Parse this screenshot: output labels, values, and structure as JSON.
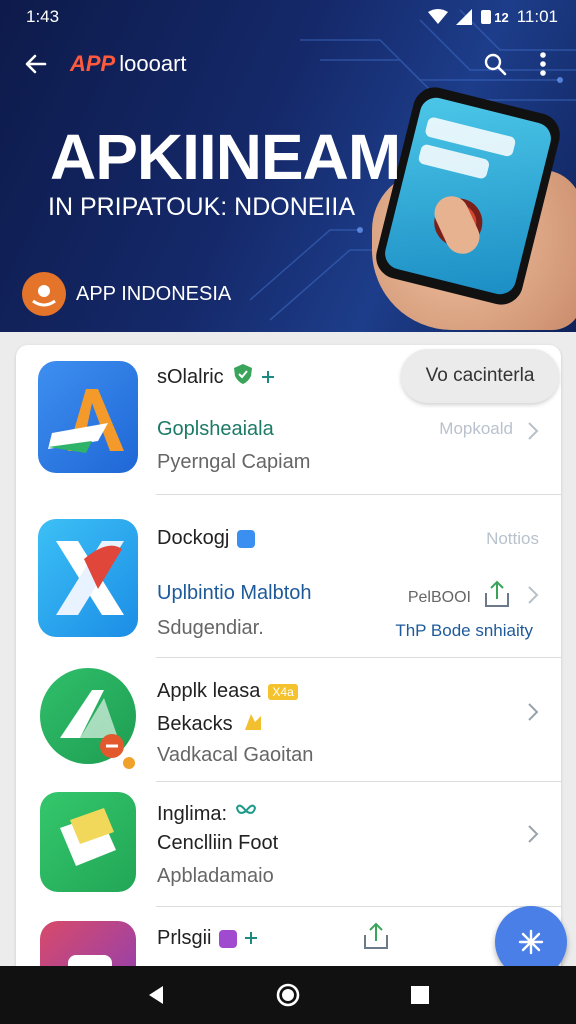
{
  "status_bar": {
    "left_time": "1:43",
    "right_time": "11:01",
    "sim_label": "12"
  },
  "header": {
    "brand_mark": "APP",
    "brand_name": "loooart",
    "hero_title": "APKIINEAM",
    "hero_subtitle": "IN PRIPATOUK: NDONEIIA",
    "badge_text": "APP INDONESIA"
  },
  "pill_button_label": "Vo cacinterla",
  "apps": [
    {
      "title": "sOlalric",
      "line2": "Goplsheaiala",
      "line3": "Pyerngal  Capiam",
      "right_label": "Mopkoald",
      "colors": {
        "bg1": "#3e8ff0",
        "bg2": "#1f67d6",
        "mark": "#f39a2b"
      }
    },
    {
      "title": "Dockogj",
      "line2": "Uplbintio Malbtoh",
      "line3": "Sdugendiar.",
      "right_label": "Nottios",
      "right_meta": "PelBOOI",
      "right_link": "ThP Bode snhiaity",
      "colors": {
        "bg1": "#3cc0f5",
        "bg2": "#1c8de6",
        "mark": "#e0463a"
      }
    },
    {
      "title": "Applk leasa",
      "title_badge": "X4a",
      "line2": "Bekacks",
      "line3": "Vadkacal Gaoitan",
      "colors": {
        "bg1": "#2fbf6a",
        "bg2": "#1f9d52",
        "mark": "#ffffff"
      }
    },
    {
      "title": "Inglima:",
      "line2": "Cenclliin Foot",
      "line3": "Apbladamaio",
      "colors": {
        "bg1": "#34c76c",
        "bg2": "#22a656",
        "mark": "#f2d85a"
      }
    },
    {
      "title": "Prlsgii",
      "colors": {
        "bg1": "#d84a6a",
        "bg2": "#8a3fb8",
        "mark": "#ffffff"
      }
    }
  ],
  "icons": {
    "back": "arrow-left-icon",
    "search": "search-icon",
    "more": "more-vert-icon",
    "fab": "sparkle-icon"
  }
}
